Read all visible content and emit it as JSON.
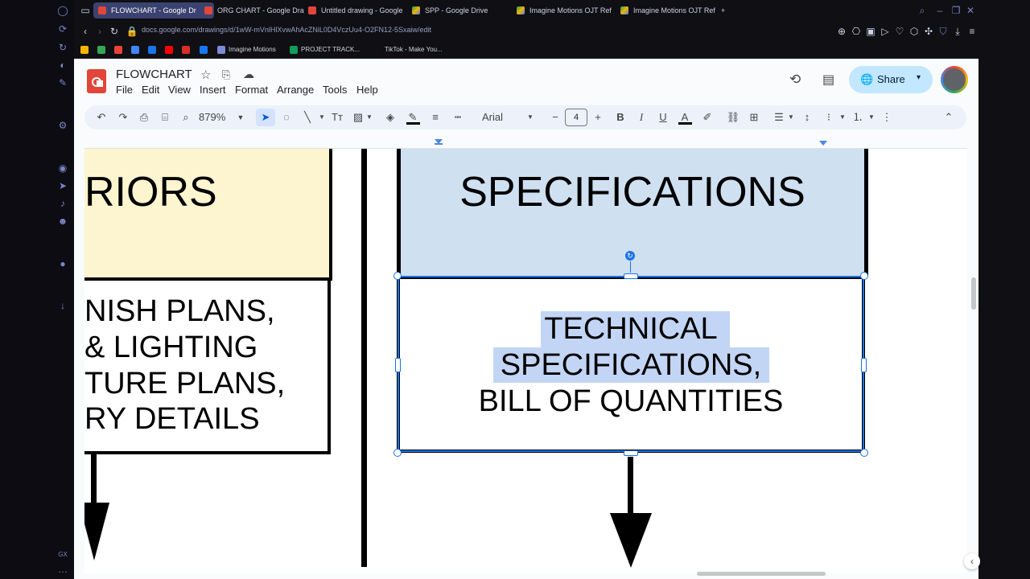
{
  "browser": {
    "tabs": [
      {
        "label": "FLOWCHART - Google Dr",
        "active": true,
        "icon": "google-drawings-icon"
      },
      {
        "label": "ORG CHART - Google Dra",
        "active": false,
        "icon": "google-drawings-icon"
      },
      {
        "label": "Untitled drawing - Google",
        "active": false,
        "icon": "google-drawings-icon"
      },
      {
        "label": "SPP - Google Drive",
        "active": false,
        "icon": "google-drive-icon"
      },
      {
        "label": "Imagine Motions OJT Ref",
        "active": false,
        "icon": "google-drive-icon"
      },
      {
        "label": "Imagine Motions OJT Ref",
        "active": false,
        "icon": "google-drive-icon"
      }
    ],
    "new_tab_label": "+",
    "address": "docs.google.com/drawings/d/1wW-mVnlHlXvwAhAcZNiL0D4VczUu4-O2FN12-5Sxaiw/edit",
    "bookmarks": [
      {
        "label": "",
        "color": "#f4b400"
      },
      {
        "label": "",
        "color": "#34a853"
      },
      {
        "label": "",
        "color": "#ea4335"
      },
      {
        "label": "",
        "color": "#4285f4"
      },
      {
        "label": "",
        "color": "#1a73e8"
      },
      {
        "label": "",
        "color": "#ff0000"
      },
      {
        "label": "",
        "color": "#d93025"
      },
      {
        "label": "",
        "color": "#1877f2"
      },
      {
        "label": "Imagine Motions",
        "color": "#7b8bd6"
      },
      {
        "label": "PROJECT TRACK...",
        "color": "#0f9d58"
      },
      {
        "label": "TikTok - Make You...",
        "color": "#111111"
      }
    ]
  },
  "docs": {
    "title": "FLOWCHART",
    "menu": [
      "File",
      "Edit",
      "View",
      "Insert",
      "Format",
      "Arrange",
      "Tools",
      "Help"
    ],
    "share_label": "Share",
    "toolbar": {
      "zoom": "879%",
      "font": "Arial",
      "font_size": "4",
      "bold": "B",
      "italic": "I",
      "underline": "U",
      "text_color": "A"
    }
  },
  "drawing": {
    "left_header": "RIORS",
    "left_body": [
      "NISH PLANS,",
      "& LIGHTING",
      "TURE PLANS,",
      "RY DETAILS"
    ],
    "right_header": "SPECIFICATIONS",
    "right_body": [
      "TECHNICAL",
      "SPECIFICATIONS,",
      "BILL OF QUANTITIES"
    ],
    "colors": {
      "left_header_fill": "#fdf5cf",
      "right_header_fill": "#cfe0f1",
      "selection": "#1a73e8",
      "text_highlight": "#c3d5f5"
    }
  }
}
